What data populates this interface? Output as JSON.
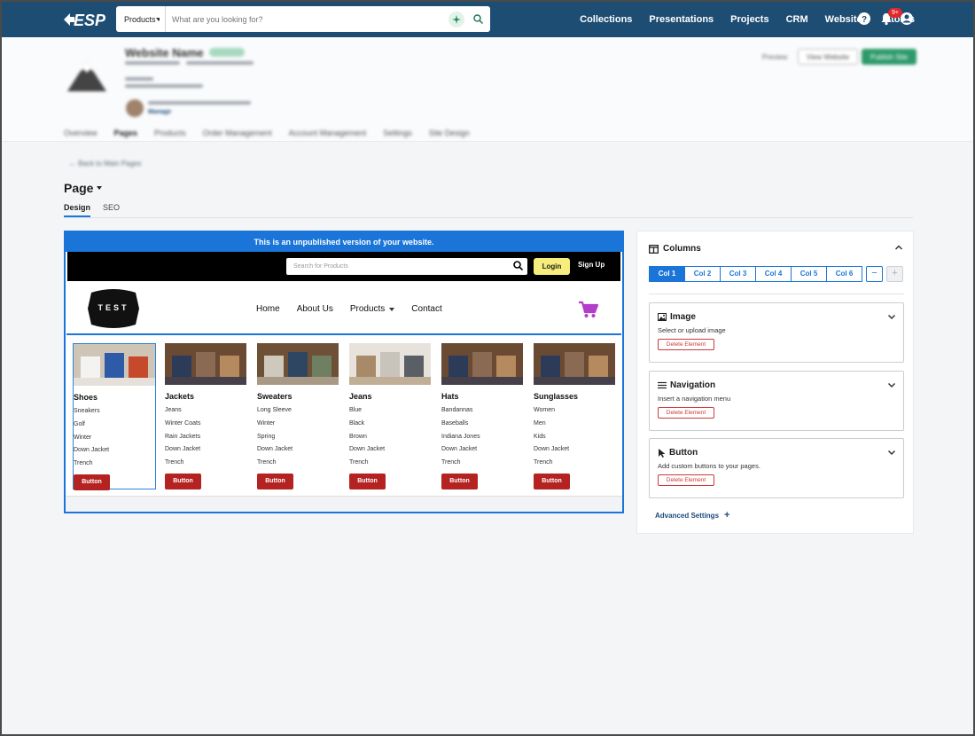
{
  "topbar": {
    "logo_text": "ESP",
    "search_scope": "Products",
    "search_placeholder": "What are you looking for?",
    "nav": [
      "Collections",
      "Presentations",
      "Projects",
      "CRM",
      "Websites",
      "Stores"
    ],
    "notification_count": "9+",
    "color": "#1d4d73"
  },
  "site_header": {
    "name": "Website Name",
    "tabs": [
      "Overview",
      "Pages",
      "Products",
      "Order Management",
      "Account Management",
      "Settings",
      "Site Design"
    ],
    "preview_label": "Preview",
    "view_label": "View Website",
    "publish_label": "Publish Site",
    "manage_label": "Manage"
  },
  "back_link": "Back to Main Pages",
  "page": {
    "title": "Page",
    "tabs": [
      "Design",
      "SEO"
    ]
  },
  "preview": {
    "banner": "This is an unpublished version of your website.",
    "search_placeholder": "Search for Products",
    "login_label": "Login",
    "signup_label": "Sign Up",
    "logo_text": "TEST",
    "menu": [
      "Home",
      "About Us",
      "Products",
      "Contact"
    ],
    "accent_color": "#1b75d9",
    "cart_color": "#b23ec9",
    "columns": [
      {
        "title": "Shoes",
        "items": [
          "Sneakers",
          "Golf",
          "Winter",
          "Down Jacket",
          "Trench"
        ],
        "button": "Button"
      },
      {
        "title": "Jackets",
        "items": [
          "Jeans",
          "Winter Coats",
          "Rain Jackets",
          "Down Jacket",
          "Trench"
        ],
        "button": "Button"
      },
      {
        "title": "Sweaters",
        "items": [
          "Long Sleeve",
          "Winter",
          "Spring",
          "Down Jacket",
          "Trench"
        ],
        "button": "Button"
      },
      {
        "title": "Jeans",
        "items": [
          "Blue",
          "Black",
          "Brown",
          "Down Jacket",
          "Trench"
        ],
        "button": "Button"
      },
      {
        "title": "Hats",
        "items": [
          "Bandannas",
          "Baseballs",
          "Indiana Jones",
          "Down Jacket",
          "Trench"
        ],
        "button": "Button"
      },
      {
        "title": "Sunglasses",
        "items": [
          "Women",
          "Men",
          "Kids",
          "Down Jacket",
          "Trench"
        ],
        "button": "Button"
      }
    ]
  },
  "panel": {
    "title": "Columns",
    "col_tabs": [
      "Col 1",
      "Col 2",
      "Col 3",
      "Col 4",
      "Col 5",
      "Col 6"
    ],
    "minus": "−",
    "plus": "+",
    "elements": [
      {
        "title": "Image",
        "desc": "Select or upload image",
        "delete": "Delete Element",
        "icon": "image-icon"
      },
      {
        "title": "Navigation",
        "desc": "Insert a navigation menu",
        "delete": "Delete Element",
        "icon": "menu-icon"
      },
      {
        "title": "Button",
        "desc": "Add custom buttons to your pages.",
        "delete": "Delete Element",
        "icon": "cursor-icon"
      }
    ],
    "advanced": "Advanced Settings"
  }
}
